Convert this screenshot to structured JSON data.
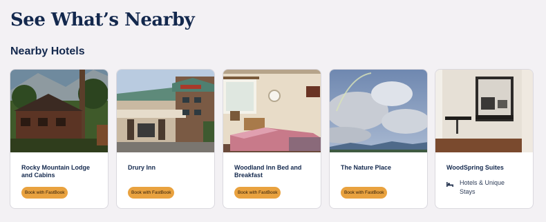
{
  "page": {
    "title": "See What’s Nearby",
    "section_title": "Nearby Hotels"
  },
  "colors": {
    "heading": "#13284d",
    "button": "#e9a23f",
    "background": "#f3f1f4",
    "card": "#ffffff"
  },
  "hotels": [
    {
      "name": "Rocky Mountain Lodge and Cabins",
      "button_label": "Book with FastBook",
      "photo_icon": "lodge-photo"
    },
    {
      "name": "Drury Inn",
      "button_label": "Book with FastBook",
      "photo_icon": "hotel-entrance-photo"
    },
    {
      "name": "Woodland Inn Bed and Breakfast",
      "button_label": "Book with FastBook",
      "photo_icon": "bedroom-photo"
    },
    {
      "name": "The Nature Place",
      "button_label": "Book with FastBook",
      "photo_icon": "sky-photo"
    },
    {
      "name": "WoodSpring Suites",
      "stay_type": "Hotels & Unique Stays",
      "stay_icon": "bed-icon",
      "photo_icon": "suite-kitchen-photo"
    }
  ]
}
